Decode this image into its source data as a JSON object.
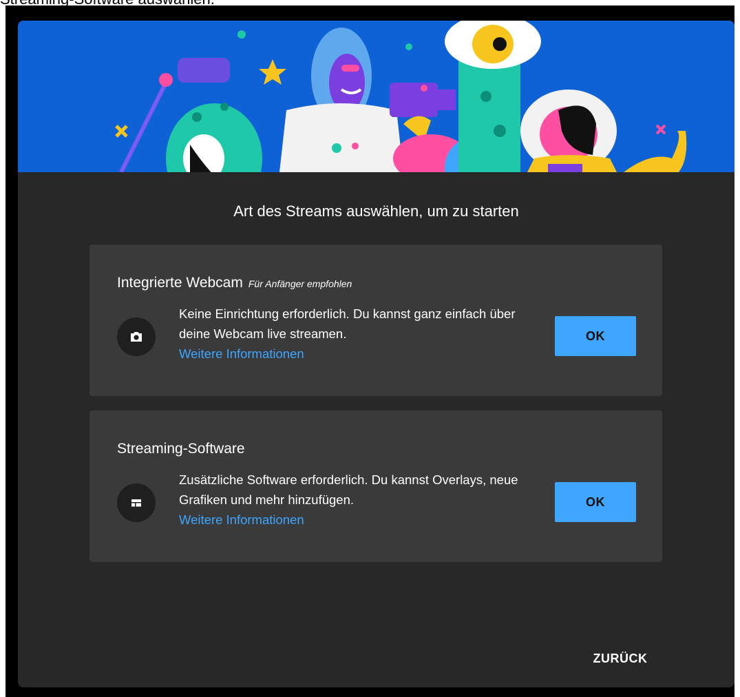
{
  "caption": "Streaming-Software auswählen.",
  "dialog": {
    "heading": "Art des Streams auswählen, um zu starten",
    "back_label": "ZURÜCK",
    "banner_color": "#0f62d6",
    "background_color": "#282828"
  },
  "options": [
    {
      "title": "Integrierte Webcam",
      "subtitle": "Für Anfänger empfohlen",
      "description": "Keine Einrichtung erforderlich. Du kannst ganz einfach über deine Webcam live streamen.",
      "link": "Weitere Informationen",
      "button": "OK",
      "icon": "camera-icon"
    },
    {
      "title": "Streaming-Software",
      "subtitle": "",
      "description": "Zusätzliche Software erforderlich. Du kannst Overlays, neue Grafiken und mehr hinzufügen.",
      "link": "Weitere Informationen",
      "button": "OK",
      "icon": "layout-icon"
    }
  ],
  "colors": {
    "accent": "#3ea6ff",
    "card": "#3a3a3a"
  }
}
